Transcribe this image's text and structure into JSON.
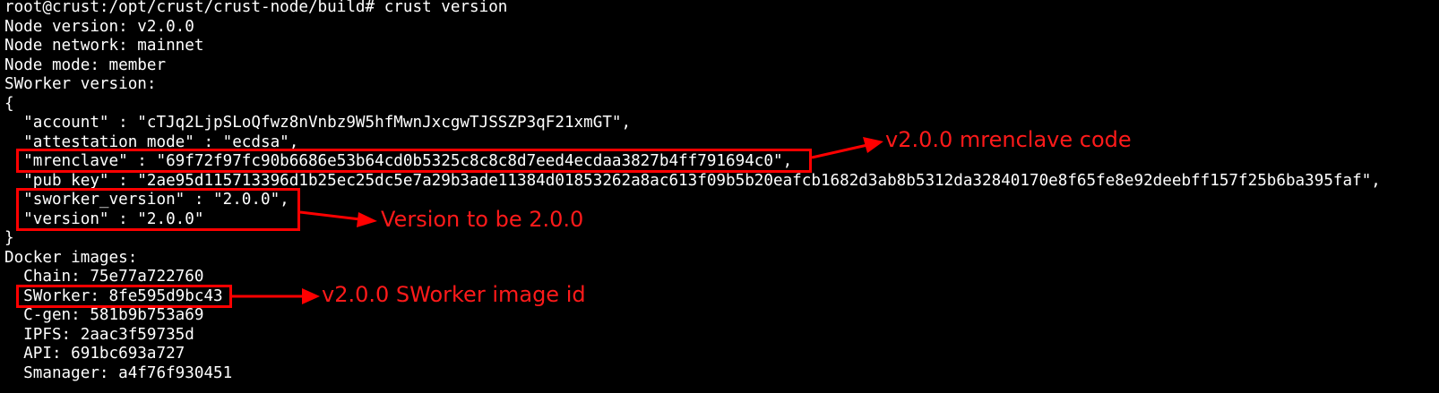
{
  "terminal": {
    "lines": [
      "root@crust:/opt/crust/crust-node/build# crust version",
      "Node version: v2.0.0",
      "Node network: mainnet",
      "Node mode: member",
      "SWorker version:",
      "{",
      "  \"account\" : \"cTJq2LjpSLoQfwz8nVnbz9W5hfMwnJxcgwTJSSZP3qF21xmGT\",",
      "  \"attestation_mode\" : \"ecdsa\",",
      "  \"mrenclave\" : \"69f72f97fc90b6686e53b64cd0b5325c8c8c8d7eed4ecdaa3827b4ff791694c0\",",
      "  \"pub_key\" : \"2ae95d115713396d1b25ec25dc5e7a29b3ade11384d01853262a8ac613f09b5b20eafcb1682d3ab8b5312da32840170e8f65fe8e92deebff157f25b6ba395faf\",",
      "  \"sworker_version\" : \"2.0.0\",",
      "  \"version\" : \"2.0.0\"",
      "}",
      "Docker images:",
      "  Chain: 75e77a722760",
      "  SWorker: 8fe595d9bc43",
      "  C-gen: 581b9b753a69",
      "  IPFS: 2aac3f59735d",
      "  API: 691bc693a727",
      "  Smanager: a4f76f930451"
    ]
  },
  "annotations": {
    "mrenclave_note": "v2.0.0 mrenclave code",
    "version_note": "Version to be 2.0.0",
    "sworker_image_note": "v2.0.0 SWorker image id"
  },
  "colors": {
    "terminal_bg": "#000000",
    "terminal_text": "#ffffff",
    "annotation": "#ff1a1a"
  }
}
